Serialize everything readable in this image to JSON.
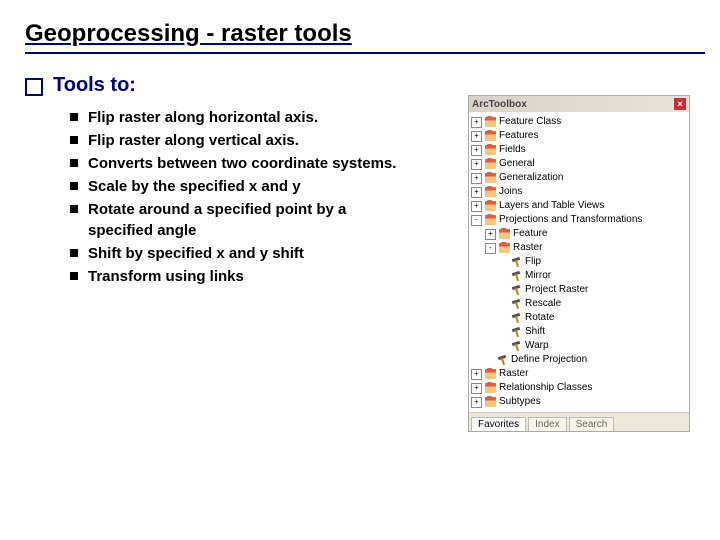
{
  "title": "Geoprocessing - raster tools",
  "section_label": "Tools to:",
  "bullets": [
    "Flip raster along horizontal axis.",
    "Flip raster along vertical axis.",
    "Converts between two coordinate systems.",
    "Scale by the specified x and y",
    "Rotate around a specified point by a specified angle",
    "Shift by specified x and y shift",
    "Transform using links"
  ],
  "toolbox": {
    "title": "ArcToolbox",
    "items": [
      {
        "level": 0,
        "exp": "+",
        "icon": "toolbox",
        "label": "Feature Class"
      },
      {
        "level": 0,
        "exp": "+",
        "icon": "toolbox",
        "label": "Features"
      },
      {
        "level": 0,
        "exp": "+",
        "icon": "toolbox",
        "label": "Fields"
      },
      {
        "level": 0,
        "exp": "+",
        "icon": "toolbox",
        "label": "General"
      },
      {
        "level": 0,
        "exp": "+",
        "icon": "toolbox",
        "label": "Generalization"
      },
      {
        "level": 0,
        "exp": "+",
        "icon": "toolbox",
        "label": "Joins"
      },
      {
        "level": 0,
        "exp": "+",
        "icon": "toolbox",
        "label": "Layers and Table Views"
      },
      {
        "level": 0,
        "exp": "-",
        "icon": "toolbox",
        "label": "Projections and Transformations"
      },
      {
        "level": 1,
        "exp": "+",
        "icon": "toolbox",
        "label": "Feature"
      },
      {
        "level": 1,
        "exp": "-",
        "icon": "toolbox",
        "label": "Raster"
      },
      {
        "level": 2,
        "exp": "",
        "icon": "hammer",
        "label": "Flip"
      },
      {
        "level": 2,
        "exp": "",
        "icon": "hammer",
        "label": "Mirror"
      },
      {
        "level": 2,
        "exp": "",
        "icon": "hammer",
        "label": "Project Raster"
      },
      {
        "level": 2,
        "exp": "",
        "icon": "hammer",
        "label": "Rescale"
      },
      {
        "level": 2,
        "exp": "",
        "icon": "hammer",
        "label": "Rotate"
      },
      {
        "level": 2,
        "exp": "",
        "icon": "hammer",
        "label": "Shift"
      },
      {
        "level": 2,
        "exp": "",
        "icon": "hammer",
        "label": "Warp"
      },
      {
        "level": 1,
        "exp": "",
        "icon": "hammer",
        "label": "Define Projection"
      },
      {
        "level": 0,
        "exp": "+",
        "icon": "toolbox",
        "label": "Raster"
      },
      {
        "level": 0,
        "exp": "+",
        "icon": "toolbox",
        "label": "Relationship Classes"
      },
      {
        "level": 0,
        "exp": "+",
        "icon": "toolbox",
        "label": "Subtypes"
      }
    ],
    "tabs": [
      "Favorites",
      "Index",
      "Search"
    ]
  }
}
